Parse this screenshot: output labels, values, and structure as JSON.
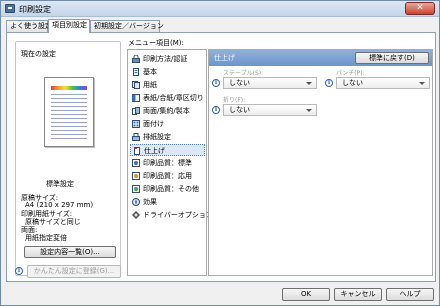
{
  "window": {
    "title": "印刷設定",
    "close_glyph": "✕"
  },
  "tabs": [
    {
      "label": "よく使う設定"
    },
    {
      "label": "項目別設定"
    },
    {
      "label": "初期設定／バージョン"
    }
  ],
  "left_panel": {
    "heading": "現在の設定",
    "profile_name": "標準設定",
    "details": [
      "原稿サイズ:",
      "A4 (210 x 297 mm)",
      "印刷用紙サイズ:",
      "原稿サイズと同じ",
      "両面:",
      "用紙指定変倍"
    ],
    "view_button": "設定内容一覧(O)...",
    "register_button": "かんたん設定に登録(G)..."
  },
  "menu": {
    "label": "メニュー項目(M):",
    "items": [
      {
        "label": "印刷方法/認証",
        "icon": "lock-print-icon"
      },
      {
        "label": "基本",
        "icon": "document-icon"
      },
      {
        "label": "用紙",
        "icon": "paper-icon"
      },
      {
        "label": "表紙/合紙/章区切り",
        "icon": "cover-icon"
      },
      {
        "label": "両面/集約/製本",
        "icon": "duplex-icon"
      },
      {
        "label": "面付け",
        "icon": "imposition-icon"
      },
      {
        "label": "排紙設定",
        "icon": "output-tray-icon"
      },
      {
        "label": "仕上げ",
        "icon": "finishing-icon"
      },
      {
        "label": "印刷品質：標準",
        "icon": "quality-icon"
      },
      {
        "label": "印刷品質：応用",
        "icon": "quality-advanced-icon"
      },
      {
        "label": "印刷品質：その他",
        "icon": "quality-other-icon"
      },
      {
        "label": "効果",
        "icon": "effect-icon"
      },
      {
        "label": "ドライバーオプション",
        "icon": "gear-icon"
      }
    ],
    "selected_index": 7
  },
  "settings": {
    "title": "仕上げ",
    "reset_button": "標準に戻す(D)",
    "staple": {
      "label": "ステープル(S):",
      "value": "しない"
    },
    "punch": {
      "label": "パンチ(P):",
      "value": "しない"
    },
    "fold": {
      "label": "折り(F):",
      "value": "しない"
    }
  },
  "footer": {
    "ok": "OK",
    "cancel": "キャンセル",
    "help": "ヘルプ"
  },
  "info_glyph": "i"
}
